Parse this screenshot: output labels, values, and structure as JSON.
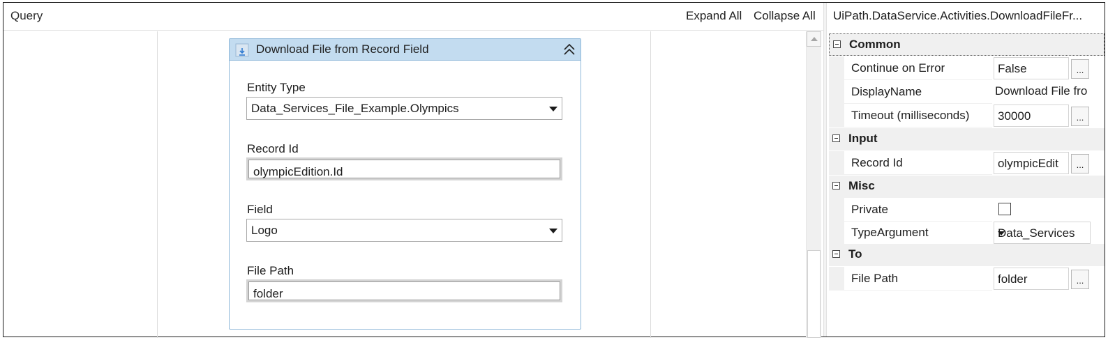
{
  "designer": {
    "breadcrumb": "Query",
    "expand_all": "Expand All",
    "collapse_all": "Collapse All"
  },
  "activity": {
    "title": "Download File from Record Field",
    "icon": "download-icon",
    "fields": {
      "entity_type": {
        "label": "Entity Type",
        "value": "Data_Services_File_Example.Olympics"
      },
      "record_id": {
        "label": "Record Id",
        "value": "olympicEdition.Id"
      },
      "field": {
        "label": "Field",
        "value": "Logo"
      },
      "file_path": {
        "label": "File Path",
        "value": "folder"
      }
    }
  },
  "properties": {
    "title": "UiPath.DataService.Activities.DownloadFileFr...",
    "categories": [
      {
        "name": "Common",
        "rows": [
          {
            "name": "Continue on Error",
            "value": "False"
          },
          {
            "name": "DisplayName",
            "value": "Download File fro"
          },
          {
            "name": "Timeout (milliseconds)",
            "value": "30000"
          }
        ]
      },
      {
        "name": "Input",
        "rows": [
          {
            "name": "Record Id",
            "value": "olympicEdit"
          }
        ]
      },
      {
        "name": "Misc",
        "rows": [
          {
            "name": "Private",
            "value": ""
          },
          {
            "name": "TypeArgument",
            "value": "Data_Services"
          }
        ]
      },
      {
        "name": "To",
        "rows": [
          {
            "name": "File Path",
            "value": "folder"
          }
        ]
      }
    ],
    "ellipsis": "..."
  }
}
